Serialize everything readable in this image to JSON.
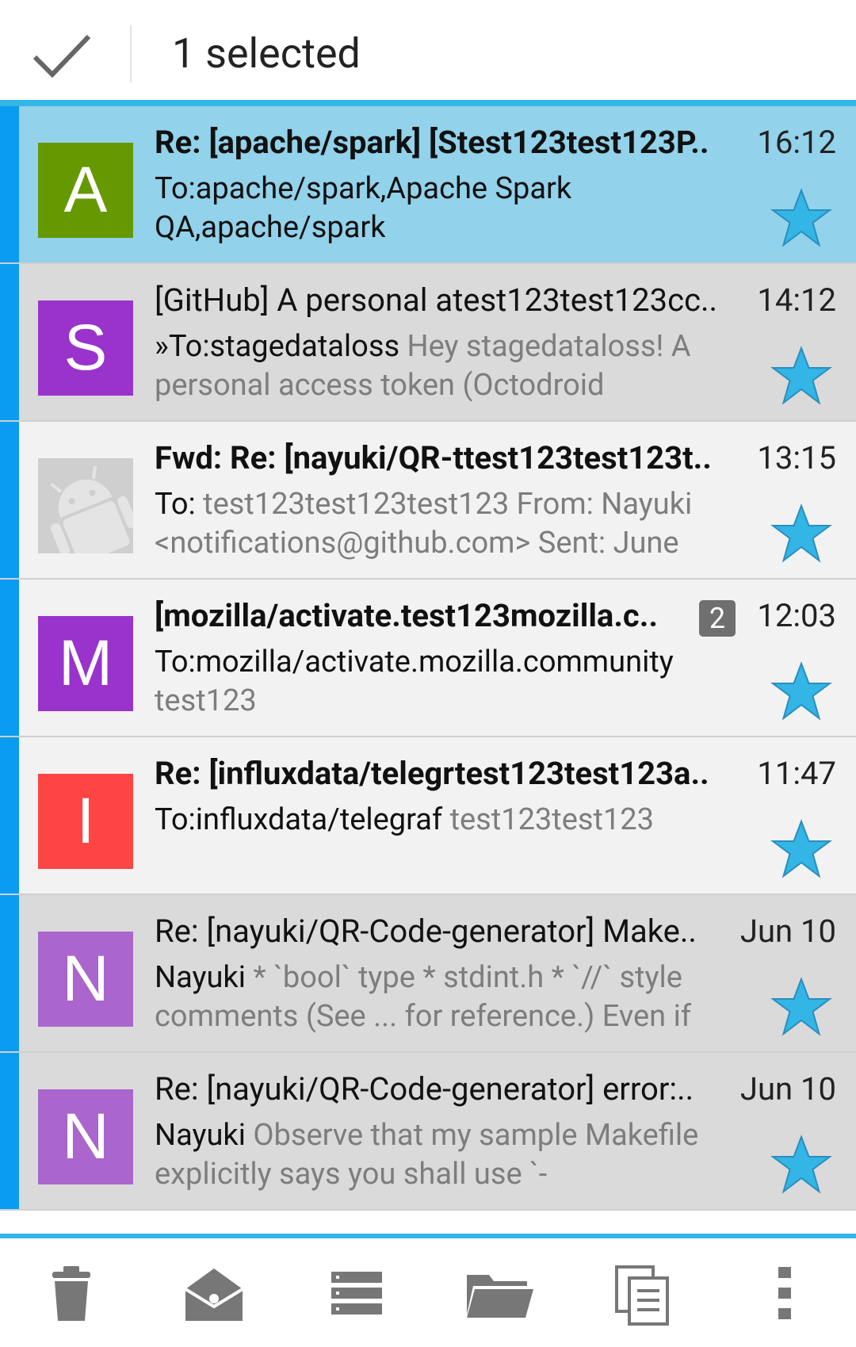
{
  "header": {
    "title": "1 selected"
  },
  "messages": [
    {
      "avatar_letter": "A",
      "avatar_color": "#669900",
      "subject": "Re: [apache/spark] [Stest123test123P..",
      "time": "16:12",
      "to": "To:apache/spark,Apache Spark QA,apache/spark",
      "snippet": "",
      "state": "selected"
    },
    {
      "avatar_letter": "S",
      "avatar_color": "#9933cc",
      "subject": "[GitHub] A personal atest123test123cc..",
      "time": "14:12",
      "to": "»To:stagedataloss",
      "snippet": " Hey stagedataloss! A personal access token (Octodroid",
      "state": "read"
    },
    {
      "avatar_letter": "",
      "avatar_icon": "android-placeholder-avatar",
      "subject": "Fwd: Re: [nayuki/QR-ttest123test123t..",
      "time": "13:15",
      "to": "To:",
      "snippet": " test123test123test123 From: Nayuki <notifications@github.com> Sent: June",
      "state": "unread"
    },
    {
      "avatar_letter": "M",
      "avatar_color": "#9933cc",
      "subject": "[mozilla/activate.test123mozilla.c..",
      "count": "2",
      "time": "12:03",
      "to": "To:mozilla/activate.mozilla.community",
      "snippet": " test123",
      "state": "unread"
    },
    {
      "avatar_letter": "I",
      "avatar_color": "#ff4444",
      "subject": "Re: [influxdata/telegrtest123test123a..",
      "time": "11:47",
      "to": "To:influxdata/telegraf",
      "snippet": " test123test123",
      "state": "unread"
    },
    {
      "avatar_letter": "N",
      "avatar_color": "#aa66cc",
      "subject": "Re: [nayuki/QR-Code-generator] Make..",
      "time": "Jun 10",
      "to": "Nayuki",
      "snippet": " * `bool` type * stdint.h * `//` style comments (See ... for reference.) Even if",
      "state": "read"
    },
    {
      "avatar_letter": "N",
      "avatar_color": "#aa66cc",
      "subject": "Re: [nayuki/QR-Code-generator] error:..",
      "time": "Jun 10",
      "to": "Nayuki",
      "snippet": " Observe that my sample Makefile explicitly says you shall use `-",
      "state": "read"
    }
  ],
  "toolbar": {
    "buttons": [
      "delete-icon",
      "mark-read-icon",
      "archive-icon",
      "move-folder-icon",
      "copy-icon",
      "overflow-menu-icon"
    ]
  },
  "colors": {
    "accent": "#33b5e5",
    "star": "#33b5e5",
    "selected_row": "#92d2ea",
    "left_bar": "#0a9cf0"
  }
}
